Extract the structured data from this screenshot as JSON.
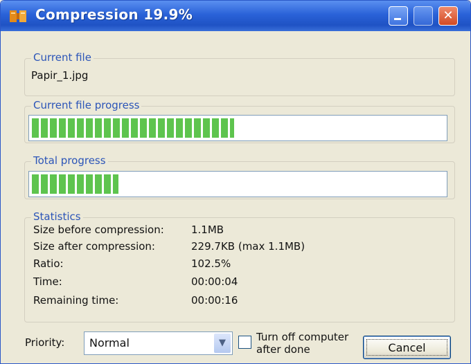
{
  "window": {
    "title": "Compression 19.9%",
    "controls": [
      "minimize",
      "maximize",
      "close"
    ]
  },
  "current_file": {
    "label": "Current file",
    "name": "Papir_1.jpg"
  },
  "current_file_progress": {
    "label": "Current file progress",
    "fraction": 0.49
  },
  "total_progress": {
    "label": "Total progress",
    "fraction": 0.21
  },
  "statistics": {
    "label": "Statistics",
    "rows": [
      {
        "label": "Size before compression:",
        "value": "1.1MB"
      },
      {
        "label": "Size after compression:",
        "value": "229.7KB (max 1.1MB)"
      },
      {
        "label": "Ratio:",
        "value": "102.5%"
      },
      {
        "label": "Time:",
        "value": "00:00:04"
      },
      {
        "label": "Remaining time:",
        "value": "00:00:16"
      }
    ]
  },
  "footer": {
    "priority_label": "Priority:",
    "priority_value": "Normal",
    "turn_off_line1": "Turn off computer",
    "turn_off_line2": "after done",
    "turn_off_checked": false,
    "cancel_label": "Cancel"
  },
  "colors": {
    "titlebar": "#2a62d8",
    "progress": "#5ec44e",
    "group_label": "#2c55b8",
    "close_button": "#d24a23"
  },
  "icons": [
    "app-icon",
    "minimize-icon",
    "maximize-icon",
    "close-icon",
    "dropdown-arrow-icon"
  ]
}
